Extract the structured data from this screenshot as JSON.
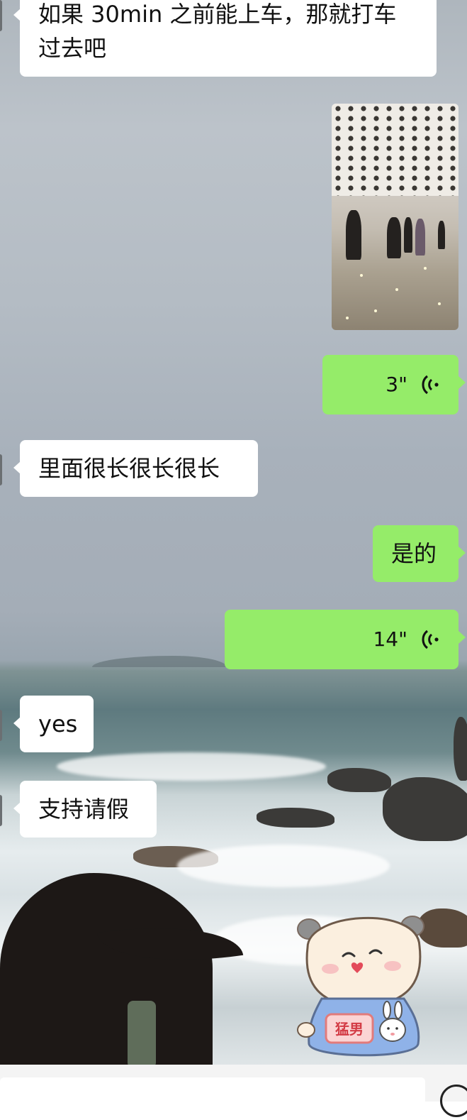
{
  "chat": {
    "messages": [
      {
        "side": "in",
        "type": "text",
        "text": "如果 30min 之前能上车，那就打车过去吧"
      },
      {
        "side": "out",
        "type": "image",
        "alt_icon": "airport-photo"
      },
      {
        "side": "out",
        "type": "voice",
        "duration": "3\""
      },
      {
        "side": "in",
        "type": "text",
        "text": "里面很长很长很长"
      },
      {
        "side": "out",
        "type": "text",
        "text": "是的"
      },
      {
        "side": "out",
        "type": "voice",
        "duration": "14\""
      },
      {
        "side": "in",
        "type": "text",
        "text": "yes"
      },
      {
        "side": "in",
        "type": "text",
        "text": "支持请假"
      }
    ]
  },
  "sticker": {
    "text": "猛男"
  },
  "colors": {
    "outgoing_bubble": "#95ec69",
    "incoming_bubble": "#ffffff"
  },
  "input_bar": {
    "emoji_icon": "emoji-icon"
  }
}
